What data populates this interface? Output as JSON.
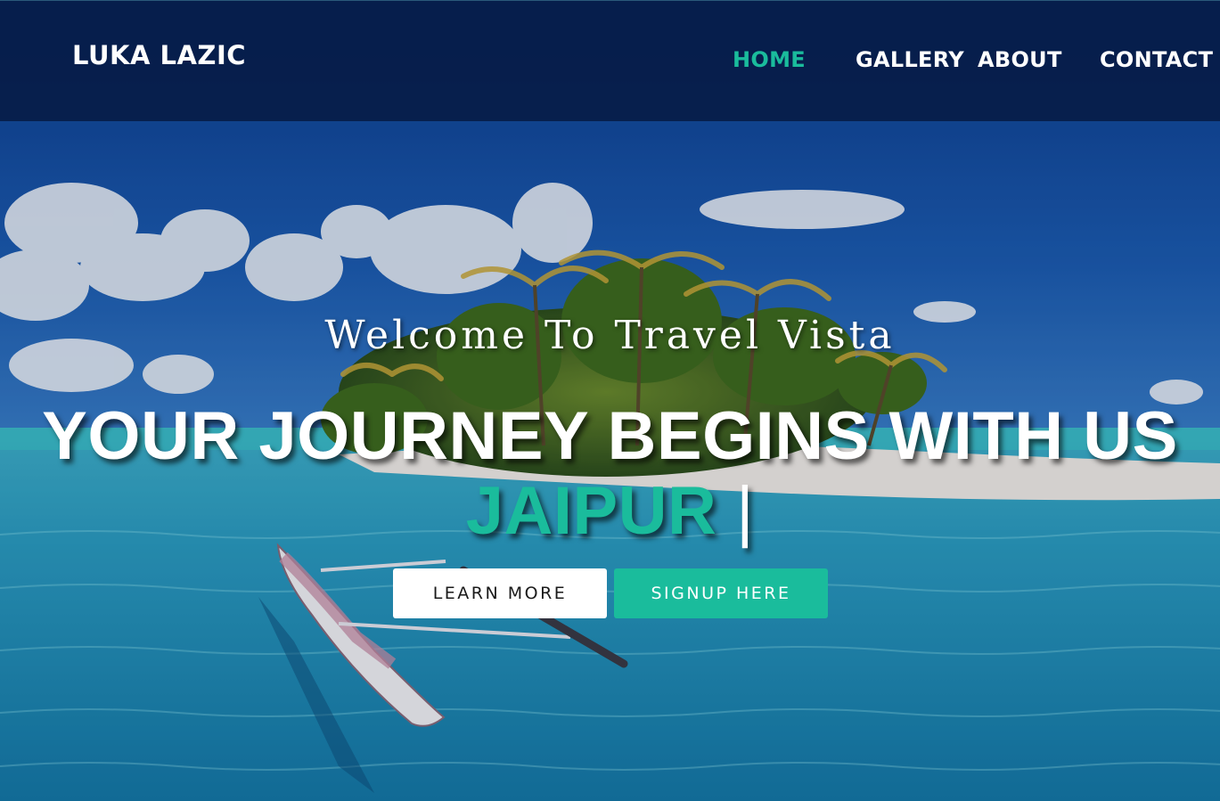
{
  "header": {
    "brand": "LUKA LAZIC",
    "nav": [
      {
        "label": "HOME",
        "active": true
      },
      {
        "label": "GALLERY",
        "active": false
      },
      {
        "label": "ABOUT",
        "active": false
      },
      {
        "label": "CONTACT",
        "active": false
      }
    ]
  },
  "hero": {
    "welcome": "Welcome To Travel Vista",
    "headline_main": "YOUR JOURNEY BEGINS WITH US",
    "headline_accent": "JAIPUR",
    "cursor": "|",
    "buttons": {
      "learn_more": "LEARN MORE",
      "signup": "SIGNUP HERE"
    }
  },
  "colors": {
    "accent": "#1abc9c",
    "header_bg": "#061c48",
    "text": "#ffffff"
  },
  "background": {
    "scene": "tropical island with palm trees, clouds, turquoise lagoon and outrigger canoe"
  }
}
